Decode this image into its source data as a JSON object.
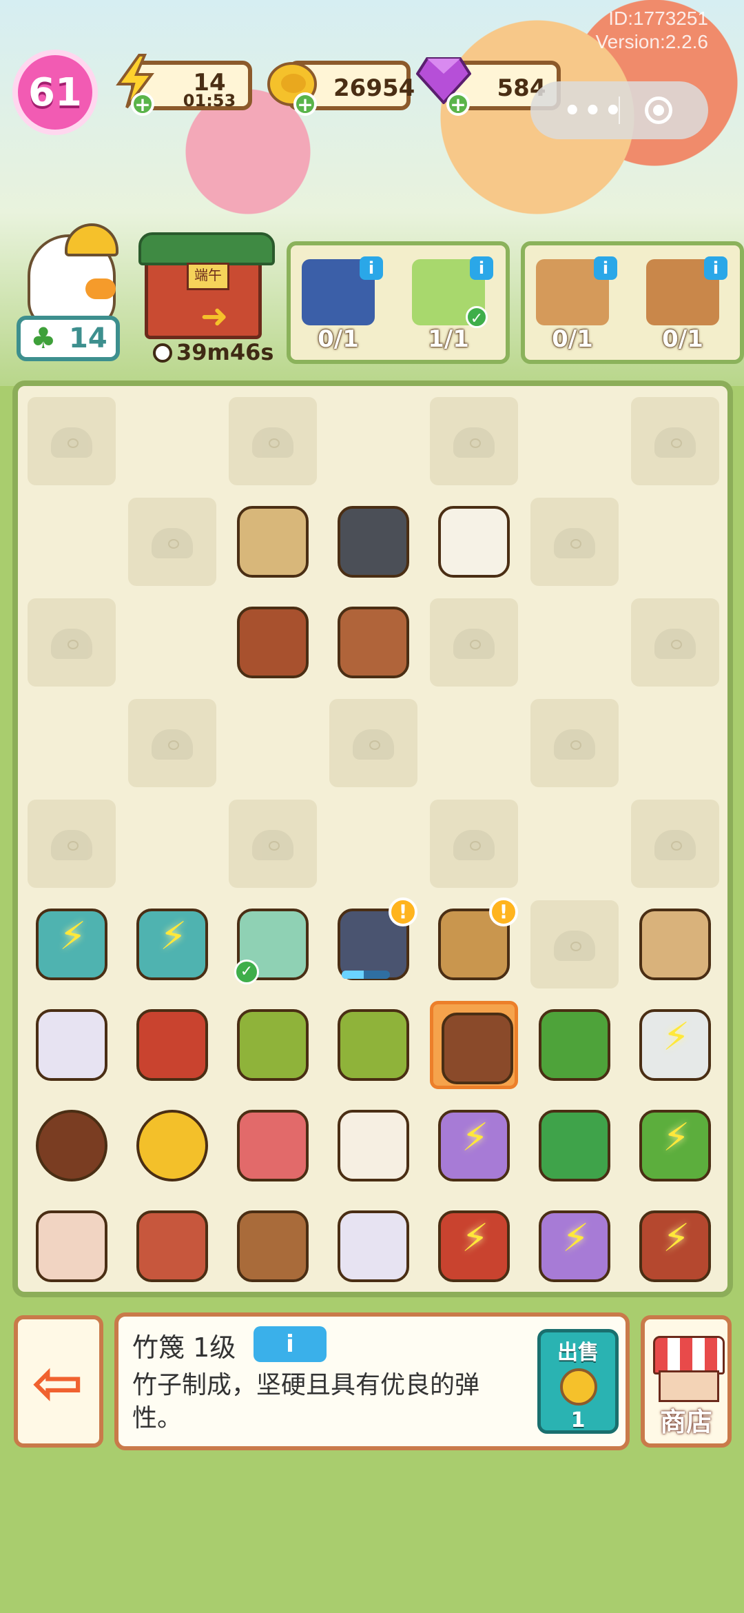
{
  "header": {
    "id_text": "ID:1773251",
    "version_text": "Version:2.2.6",
    "level": "61",
    "energy": {
      "value": "14",
      "timer": "01:53",
      "icon": "lightning-icon"
    },
    "coins": {
      "value": "26954",
      "icon": "gold-coin-icon"
    },
    "gems": {
      "value": "584",
      "icon": "purple-gem-icon"
    },
    "capsule": {
      "more": "•••",
      "close": "target-icon"
    }
  },
  "left_panel": {
    "clover_count": "14",
    "event_timer": "39m46s",
    "gate_sign": "端午"
  },
  "orders": [
    {
      "items": [
        {
          "name": "blue-book",
          "count": "0/1",
          "done": false,
          "color": "#3b5fa8"
        },
        {
          "name": "hanfu-dress",
          "count": "1/1",
          "done": true,
          "color": "#7fc7a6"
        }
      ]
    },
    {
      "items": [
        {
          "name": "wood-log",
          "count": "0/1",
          "done": false,
          "color": "#d59a5a"
        },
        {
          "name": "wood-pile",
          "count": "0/1",
          "done": false,
          "color": "#c9874a"
        }
      ]
    }
  ],
  "board": {
    "rows": [
      [
        "locked",
        "open",
        "locked",
        "open",
        "locked",
        "open",
        "locked"
      ],
      [
        "open",
        "locked",
        "scroll",
        "inkstone",
        "paper",
        "locked",
        "open"
      ],
      [
        "locked",
        "open",
        "chest-large",
        "chest-small",
        "locked",
        "open",
        "locked"
      ],
      [
        "open",
        "locked",
        "open",
        "locked",
        "open",
        "locked",
        "open"
      ],
      [
        "locked",
        "open",
        "locked",
        "open",
        "locked",
        "open",
        "locked"
      ],
      [
        "dragon",
        "dragon",
        "hanfu",
        "mill",
        "basket",
        "locked",
        "rice-sack"
      ],
      [
        "cream-jar",
        "lion-pouch",
        "green-pouch",
        "green-pouch",
        "bamboo-strip",
        "herb",
        "glass-jar"
      ],
      [
        "chestnut",
        "coin",
        "bracelet",
        "egg",
        "kite",
        "plant-pot",
        "leaves"
      ],
      [
        "drum",
        "meat",
        "log",
        "cream-jar",
        "lion-pouch",
        "kite",
        "stall"
      ]
    ],
    "item_colors": {
      "scroll": "#d8b77a",
      "inkstone": "#4b4f57",
      "paper": "#f6f2e6",
      "chest-large": "#a8512e",
      "chest-small": "#b0643a",
      "dragon": "#4fb3b0",
      "hanfu": "#8fd1b4",
      "mill": "#4a5470",
      "basket": "#c9964e",
      "rice-sack": "#d9b27b",
      "cream-jar": "#e7e3f2",
      "lion-pouch": "#c9432f",
      "green-pouch": "#8fb33a",
      "bamboo-strip": "#8a4a2a",
      "herb": "#4ea33a",
      "glass-jar": "#e6e9e8",
      "chestnut": "#7a3d22",
      "coin": "#f3c02a",
      "bracelet": "#e26a6a",
      "egg": "#f6efe2",
      "kite": "#a77bd6",
      "plant-pot": "#3fa34a",
      "leaves": "#5cae3d",
      "drum": "#f1d4c2",
      "meat": "#c7573d",
      "log": "#a96b3a",
      "stall": "#b5482f"
    },
    "charged_items": [
      "5-0",
      "5-1",
      "6-6",
      "7-4",
      "7-6",
      "8-4",
      "8-5",
      "8-6"
    ],
    "alert_items": [
      "5-3",
      "5-4"
    ],
    "checked_items": [
      "5-2"
    ],
    "selected": "6-4",
    "mill_progress": 0.45
  },
  "info_bar": {
    "item_title": "竹篾 1级",
    "info_label": "i",
    "description": "竹子制成，坚硬且具有优良的弹性。",
    "sell_label": "出售",
    "sell_price": "1",
    "shop_label": "商店"
  }
}
